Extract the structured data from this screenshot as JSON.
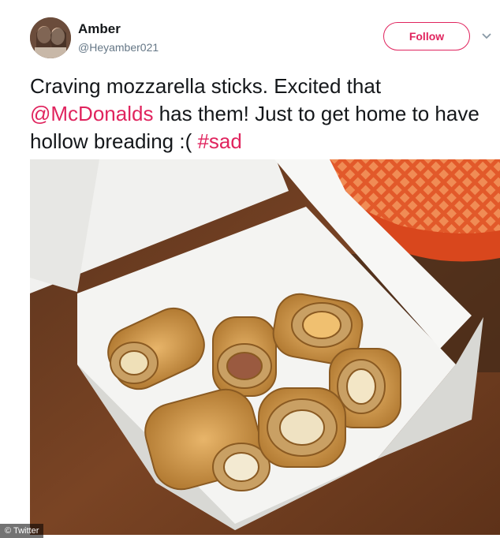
{
  "user": {
    "name": "Amber",
    "handle": "@Heyamber021"
  },
  "follow_label": "Follow",
  "tweet": {
    "text_1": "Craving mozzarella sticks. Excited that",
    "mention": "@McDonalds",
    "text_2": " has them! Just to get home to have hollow breading :( ",
    "hashtag": "#sad"
  },
  "credit": "© Twitter",
  "colors": {
    "accent": "#e0245e",
    "handle": "#657786"
  },
  "icons": {
    "menu": "chevron-down-icon"
  }
}
